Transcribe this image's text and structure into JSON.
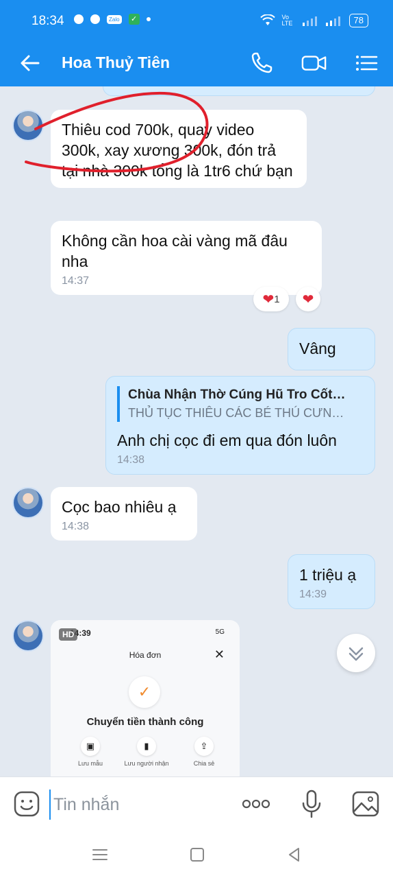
{
  "status_bar": {
    "time": "18:34",
    "network": "Vo LTE",
    "battery": "78"
  },
  "header": {
    "title": "Hoa Thuỷ Tiên"
  },
  "messages": [
    {
      "side": "in",
      "text": "Thiêu cod 700k, quay video 300k, xay xương 300k, đón trả tại nhà 300k tổng là 1tr6 chứ bạn"
    },
    {
      "side": "in",
      "text": "Không cần hoa cài vàng mã đâu nha",
      "time": "14:37",
      "reaction_count": "1"
    },
    {
      "side": "out",
      "text": "Vâng"
    },
    {
      "side": "out",
      "quote_title": "Chùa Nhận Thờ Cúng Hũ Tro Cốt…",
      "quote_subtitle": "THỦ TỤC THIÊU CÁC BÉ THÚ CƯN…",
      "text": "Anh chị cọc đi em qua đón luôn",
      "time": "14:38"
    },
    {
      "side": "in",
      "text": "Cọc bao nhiêu ạ",
      "time": "14:38"
    },
    {
      "side": "out",
      "text": "1 triệu ạ",
      "time": "14:39"
    }
  ],
  "image_message": {
    "badge": "HD",
    "time": "14:39",
    "network": "5G",
    "title": "Hóa đơn",
    "success_text": "Chuyển tiền thành công",
    "actions": [
      "Lưu mẫu",
      "Lưu người nhận",
      "Chia sẻ"
    ]
  },
  "composer": {
    "placeholder": "Tin nhắn"
  },
  "colors": {
    "accent": "#1a8ef0",
    "outgoing_bubble": "#d5ecfe",
    "annotation": "#e0202c"
  }
}
